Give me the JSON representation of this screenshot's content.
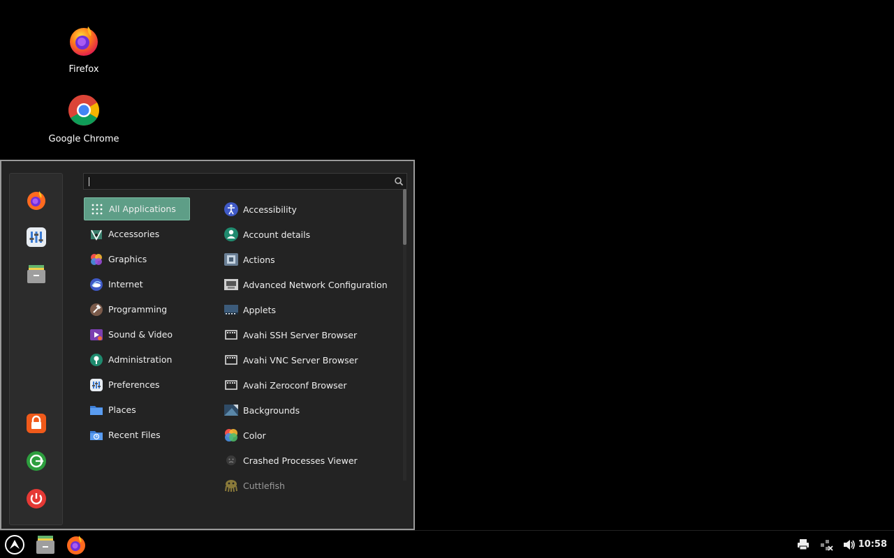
{
  "desktop": {
    "icons": [
      {
        "label": "Firefox",
        "icon": "firefox-icon"
      },
      {
        "label": "Google Chrome",
        "icon": "chrome-icon"
      }
    ]
  },
  "menu": {
    "search": {
      "value": "",
      "placeholder": ""
    },
    "favorites": [
      "firefox-icon",
      "settings-icon",
      "files-icon"
    ],
    "session": [
      "lock-screen-icon",
      "logout-icon",
      "shutdown-icon"
    ],
    "categories": [
      {
        "label": "All Applications",
        "icon": "grid-icon",
        "selected": true
      },
      {
        "label": "Accessories",
        "icon": "accessories-icon"
      },
      {
        "label": "Graphics",
        "icon": "graphics-icon"
      },
      {
        "label": "Internet",
        "icon": "internet-icon"
      },
      {
        "label": "Programming",
        "icon": "programming-icon"
      },
      {
        "label": "Sound & Video",
        "icon": "sound-video-icon"
      },
      {
        "label": "Administration",
        "icon": "administration-icon"
      },
      {
        "label": "Preferences",
        "icon": "preferences-icon"
      },
      {
        "label": "Places",
        "icon": "folder-icon"
      },
      {
        "label": "Recent Files",
        "icon": "recent-files-icon"
      }
    ],
    "apps": [
      {
        "label": "Accessibility",
        "icon": "accessibility-icon"
      },
      {
        "label": "Account details",
        "icon": "account-icon"
      },
      {
        "label": "Actions",
        "icon": "actions-icon"
      },
      {
        "label": "Advanced Network Configuration",
        "icon": "network-icon"
      },
      {
        "label": "Applets",
        "icon": "applets-icon"
      },
      {
        "label": "Avahi SSH Server Browser",
        "icon": "avahi-ssh-icon"
      },
      {
        "label": "Avahi VNC Server Browser",
        "icon": "avahi-vnc-icon"
      },
      {
        "label": "Avahi Zeroconf Browser",
        "icon": "avahi-zeroconf-icon"
      },
      {
        "label": "Backgrounds",
        "icon": "backgrounds-icon"
      },
      {
        "label": "Color",
        "icon": "color-icon"
      },
      {
        "label": "Crashed Processes Viewer",
        "icon": "crash-icon"
      },
      {
        "label": "Cuttlefish",
        "icon": "cuttlefish-icon"
      }
    ]
  },
  "taskbar": {
    "clock": "10:58",
    "items": [
      "menu-icon",
      "files-icon",
      "firefox-icon"
    ],
    "tray": [
      "printer-icon",
      "network-off-icon",
      "volume-icon"
    ]
  },
  "colors": {
    "selection": "#5e9e87",
    "menu_bg": "#232323"
  }
}
